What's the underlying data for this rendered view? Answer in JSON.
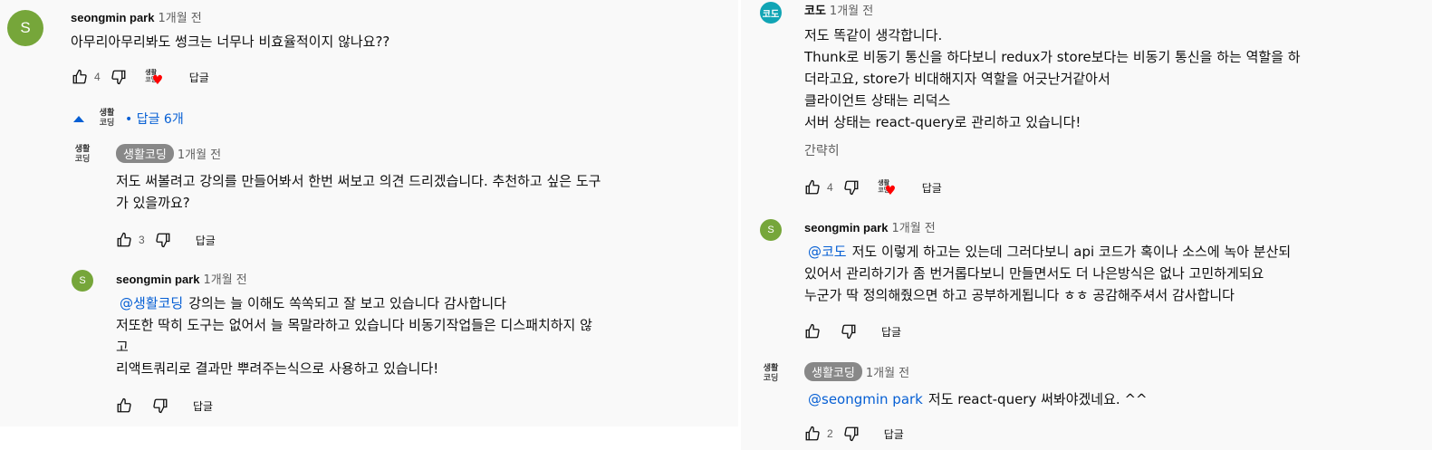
{
  "left": {
    "top_comment": {
      "avatar_letter": "S",
      "author": "seongmin park",
      "time": "1개월 전",
      "text": "아무리아무리봐도 썽크는 너무나 비효율적이지 않나요??",
      "likes": "4",
      "reply_label": "답글"
    },
    "replies_toggle": {
      "logo_line1": "생활",
      "logo_line2": "코딩",
      "label": "• 답글 6개"
    },
    "reply1": {
      "logo_line1": "생활",
      "logo_line2": "코딩",
      "author_badge": "생활코딩",
      "time": "1개월 전",
      "text": "저도 써볼려고 강의를 만들어봐서 한번 써보고 의견 드리겠습니다. 추천하고 싶은 도구\n가 있을까요?",
      "likes": "3",
      "reply_label": "답글"
    },
    "reply2": {
      "avatar_letter": "S",
      "author": "seongmin park",
      "time": "1개월 전",
      "mention": "@생활코딩",
      "text_first": "강의는 늘 이해도 쏙쏙되고 잘 보고 있습니다 감사합니다",
      "text_rest": "저또한 딱히 도구는 없어서 늘 목말라하고 있습니다 비동기작업들은 디스패치하지 않\n고\n리액트쿼리로 결과만 뿌려주는식으로 사용하고 있습니다!",
      "reply_label": "답글"
    }
  },
  "right": {
    "comment1": {
      "avatar_text": "코도",
      "author": "코도",
      "time": "1개월 전",
      "text": "저도 똑같이 생각합니다.\nThunk로 비동기 통신을 하다보니 redux가 store보다는 비동기 통신을 하는 역할을 하\n더라고요, store가 비대해지자 역할을 어긋난거같아서\n클라이언트 상태는 리덕스\n서버 상태는 react-query로 관리하고 있습니다!",
      "collapse_label": "간략히",
      "likes": "4",
      "reply_label": "답글"
    },
    "comment2": {
      "avatar_letter": "S",
      "author": "seongmin park",
      "time": "1개월 전",
      "mention": "@코도",
      "text_first": "저도 이렇게 하고는 있는데 그러다보니 api 코드가 혹이나 소스에 녹아 분산되",
      "text_rest": "있어서 관리하기가 좀 번거롭다보니 만들면서도 더 나은방식은 없나 고민하게되요\n누군가 딱 정의해줬으면 하고 공부하게됩니다 ㅎㅎ 공감해주셔서 감사합니다",
      "reply_label": "답글"
    },
    "comment3": {
      "logo_line1": "생활",
      "logo_line2": "코딩",
      "author_badge": "생활코딩",
      "time": "1개월 전",
      "mention": "@seongmin park",
      "text_first": "저도 react-query 써봐야겠네요. ^^",
      "likes": "2",
      "reply_label": "답글"
    }
  },
  "heart_logo": {
    "line1": "생활",
    "line2": "코딩",
    "heart": "♥"
  },
  "colors": {
    "link": "#065fd4",
    "heart": "#ff0000",
    "avatar_s": "#76a63a",
    "avatar_kodo": "#11a5b5",
    "badge": "#888888"
  },
  "icons": [
    "thumb-up-icon",
    "thumb-down-icon",
    "caret-up-icon",
    "heart-icon"
  ]
}
